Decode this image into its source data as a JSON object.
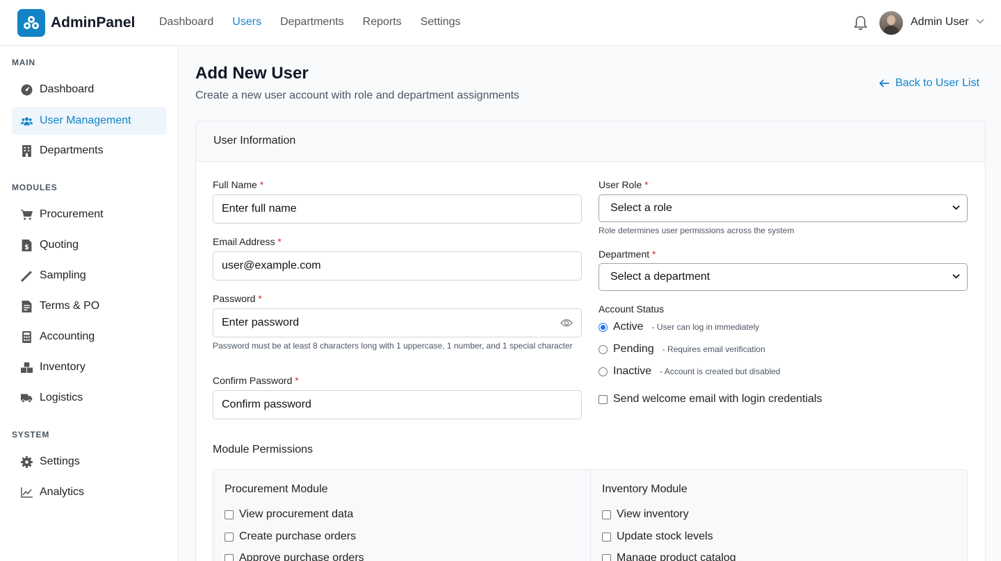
{
  "app": {
    "name": "AdminPanel"
  },
  "topnav": {
    "items": [
      "Dashboard",
      "Users",
      "Departments",
      "Reports",
      "Settings"
    ],
    "active": "Users",
    "user_name": "Admin User"
  },
  "sidebar": {
    "sections": {
      "main": "MAIN",
      "modules": "MODULES",
      "system": "SYSTEM"
    },
    "main_items": [
      {
        "label": "Dashboard",
        "icon": "gauge-icon"
      },
      {
        "label": "User Management",
        "icon": "users-icon",
        "active": true
      },
      {
        "label": "Departments",
        "icon": "building-icon"
      }
    ],
    "module_items": [
      {
        "label": "Procurement",
        "icon": "cart-icon"
      },
      {
        "label": "Quoting",
        "icon": "invoice-icon"
      },
      {
        "label": "Sampling",
        "icon": "flask-icon"
      },
      {
        "label": "Terms & PO",
        "icon": "contract-icon"
      },
      {
        "label": "Accounting",
        "icon": "calculator-icon"
      },
      {
        "label": "Inventory",
        "icon": "boxes-icon"
      },
      {
        "label": "Logistics",
        "icon": "truck-icon"
      }
    ],
    "system_items": [
      {
        "label": "Settings",
        "icon": "gear-icon"
      },
      {
        "label": "Analytics",
        "icon": "chart-line-icon"
      }
    ]
  },
  "page": {
    "title": "Add New User",
    "subtitle": "Create a new user account with role and department assignments",
    "back_link": "Back to User List"
  },
  "card": {
    "header": "User Information"
  },
  "form": {
    "full_name": {
      "label": "Full Name",
      "placeholder": "Enter full name"
    },
    "email": {
      "label": "Email Address",
      "placeholder": "user@example.com"
    },
    "password": {
      "label": "Password",
      "placeholder": "Enter password",
      "help": "Password must be at least 8 characters long with 1 uppercase, 1 number, and 1 special character"
    },
    "confirm_password": {
      "label": "Confirm Password",
      "placeholder": "Confirm password"
    },
    "role": {
      "label": "User Role",
      "value": "Select a role",
      "help": "Role determines user permissions across the system"
    },
    "department": {
      "label": "Department",
      "value": "Select a department"
    },
    "status": {
      "label": "Account Status",
      "options": [
        {
          "label": "Active",
          "desc": "- User can log in immediately",
          "checked": true
        },
        {
          "label": "Pending",
          "desc": "- Requires email verification",
          "checked": false
        },
        {
          "label": "Inactive",
          "desc": "- Account is created but disabled",
          "checked": false
        }
      ]
    },
    "welcome_email": "Send welcome email with login credentials",
    "required_marker": "*"
  },
  "permissions": {
    "title": "Module Permissions",
    "modules": [
      {
        "name": "Procurement Module",
        "items": [
          "View procurement data",
          "Create purchase orders",
          "Approve purchase orders"
        ]
      },
      {
        "name": "Inventory Module",
        "items": [
          "View inventory",
          "Update stock levels",
          "Manage product catalog"
        ]
      }
    ]
  },
  "colors": {
    "accent": "#1284c6",
    "required": "#dc2626",
    "active_bg": "#eef5fb"
  }
}
